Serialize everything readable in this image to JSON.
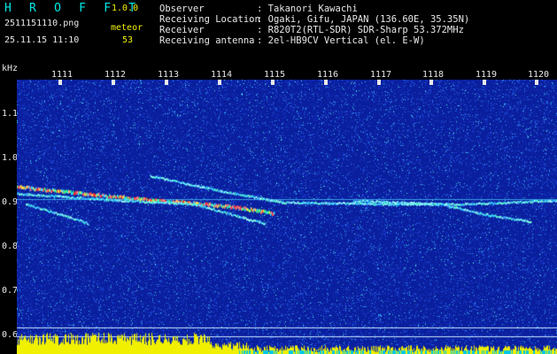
{
  "header": {
    "logo": "H R O F F T",
    "version": "1.0.0",
    "filename": "2511151110.png",
    "mode": "meteor",
    "datetime": "25.11.15 11:10",
    "meteor_count": "53"
  },
  "info": [
    {
      "key": "Observer",
      "value": ": Takanori Kawachi"
    },
    {
      "key": "Receiving Location",
      "value": ": Ogaki, Gifu, JAPAN (136.60E, 35.35N)"
    },
    {
      "key": "Receiver",
      "value": ": R820T2(RTL-SDR) SDR-Sharp 53.372MHz"
    },
    {
      "key": "Receiving antenna",
      "value": ": 2el-HB9CV Vertical (el. E-W)"
    }
  ],
  "axis": {
    "y_unit": "kHz",
    "x_ticks": [
      "1111",
      "1112",
      "1113",
      "1114",
      "1115",
      "1116",
      "1117",
      "1118",
      "1119",
      "1120"
    ],
    "y_ticks": [
      "1.1",
      "1.0",
      "0.9",
      "0.8",
      "0.7",
      "0.6"
    ]
  },
  "colors": {
    "background": "#0a1f9e",
    "header_text": "#00e8e8",
    "accent_text": "#f0f000",
    "signal_bar": "#f0f000"
  }
}
